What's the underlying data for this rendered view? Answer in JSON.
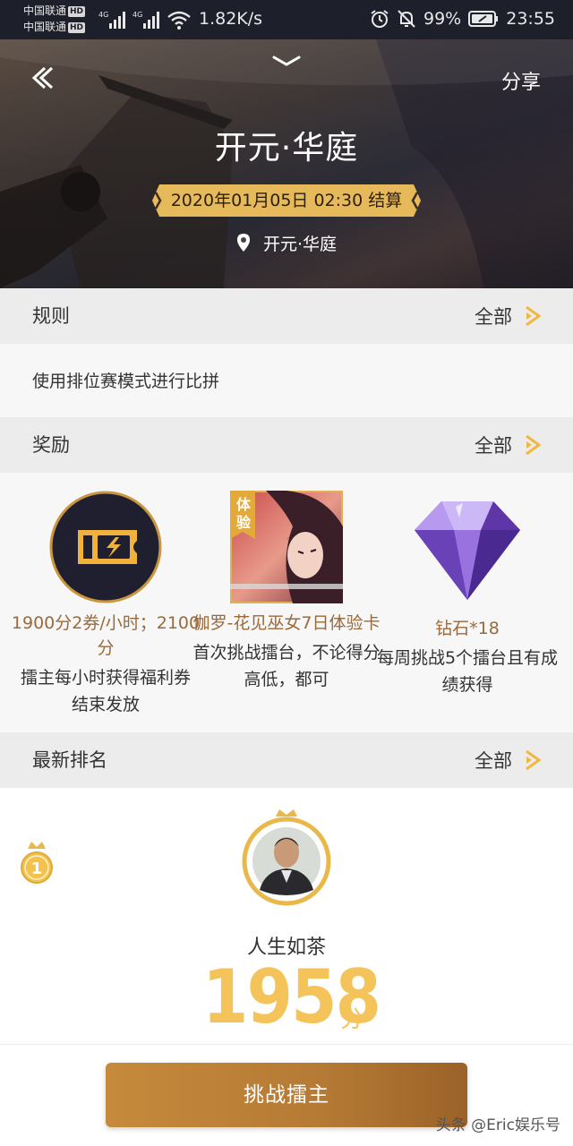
{
  "status_bar": {
    "carrier_1": "中国联通",
    "carrier_2": "中国联通",
    "hd_badge": "HD",
    "net_tag_1": "4G",
    "net_tag_2": "4G",
    "net_speed": "1.82K/s",
    "battery": "99%",
    "time": "23:55",
    "icons": [
      "signal-icon",
      "wifi-icon",
      "alarm-icon",
      "mute-icon",
      "battery-icon"
    ]
  },
  "header": {
    "share_label": "分享",
    "title": "开元·华庭",
    "settle_label": "2020年01月05日 02:30 结算",
    "location": "开元·华庭"
  },
  "sections": {
    "rules": {
      "title": "规则",
      "more": "全部",
      "body": "使用排位赛模式进行比拼"
    },
    "rewards": {
      "title": "奖励",
      "more": "全部"
    },
    "ranking": {
      "title": "最新排名",
      "more": "全部"
    }
  },
  "rewards": [
    {
      "icon": "ticket-icon",
      "name": "1900分2券/小时；2100分",
      "desc": "擂主每小时获得福利券 结束发放"
    },
    {
      "icon": "hero-skin-card",
      "tag": "体验",
      "name": "伽罗-花见巫女7日体验卡",
      "desc": "首次挑战擂台，不论得分高低，都可"
    },
    {
      "icon": "diamond-icon",
      "name": "钻石*18",
      "desc": "每周挑战5个擂台且有成绩获得"
    }
  ],
  "ranking": {
    "rank": "1",
    "player_name": "人生如茶",
    "score": "1958",
    "unit": "分"
  },
  "challenge_button": "挑战擂主",
  "watermark": "头条 @Eric娱乐号",
  "colors": {
    "accent": "#f4c45a",
    "button": "#b57a34",
    "reward_name": "#9a6a3a",
    "section_bg": "#ececec"
  }
}
